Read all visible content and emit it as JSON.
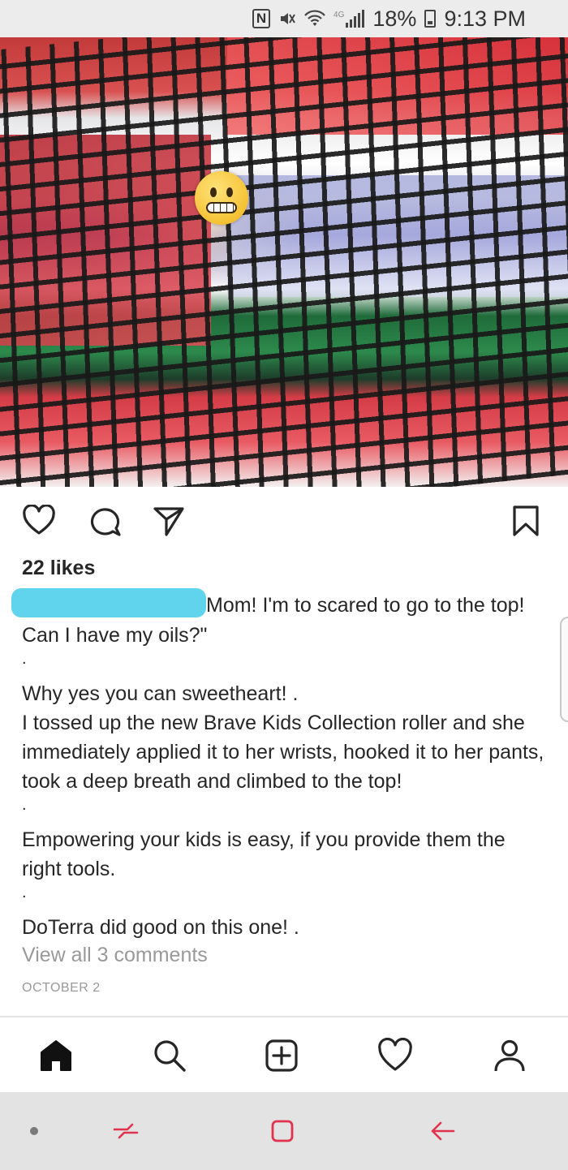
{
  "status_bar": {
    "network_label": "4G",
    "battery": "18%",
    "time": "9:13 PM"
  },
  "post": {
    "likes": "22 likes",
    "caption_first_line": "Mom! I'm to scared to go to the top! Can I have my oils?\"",
    "caption_sep_1": ".",
    "caption_para_2_line_1": "Why yes you can sweetheart! .",
    "caption_para_2_line_2": "I tossed up the new Brave Kids Collection roller and she immediately applied it to her wrists, hooked it to her pants, took a deep breath and climbed to the top!",
    "caption_sep_2": ".",
    "caption_para_3": "Empowering your kids is easy, if you provide them the right tools.",
    "caption_sep_3": ".",
    "caption_para_4": "DoTerra did good on this one! .",
    "view_comments": "View all 3 comments",
    "date": "OCTOBER 2"
  },
  "actions": {
    "icons": [
      "heart-icon",
      "comment-icon",
      "share-icon",
      "bookmark-icon"
    ]
  },
  "tabbar": {
    "icons": [
      "home-icon",
      "search-icon",
      "add-post-icon",
      "activity-heart-icon",
      "profile-icon"
    ]
  },
  "navbar": {
    "icons": [
      "dot-icon",
      "recent-apps-icon",
      "home-square-icon",
      "back-arrow-icon"
    ]
  },
  "colors": {
    "redaction": "#5fd4ec",
    "text": "#262626",
    "muted": "#999999"
  }
}
